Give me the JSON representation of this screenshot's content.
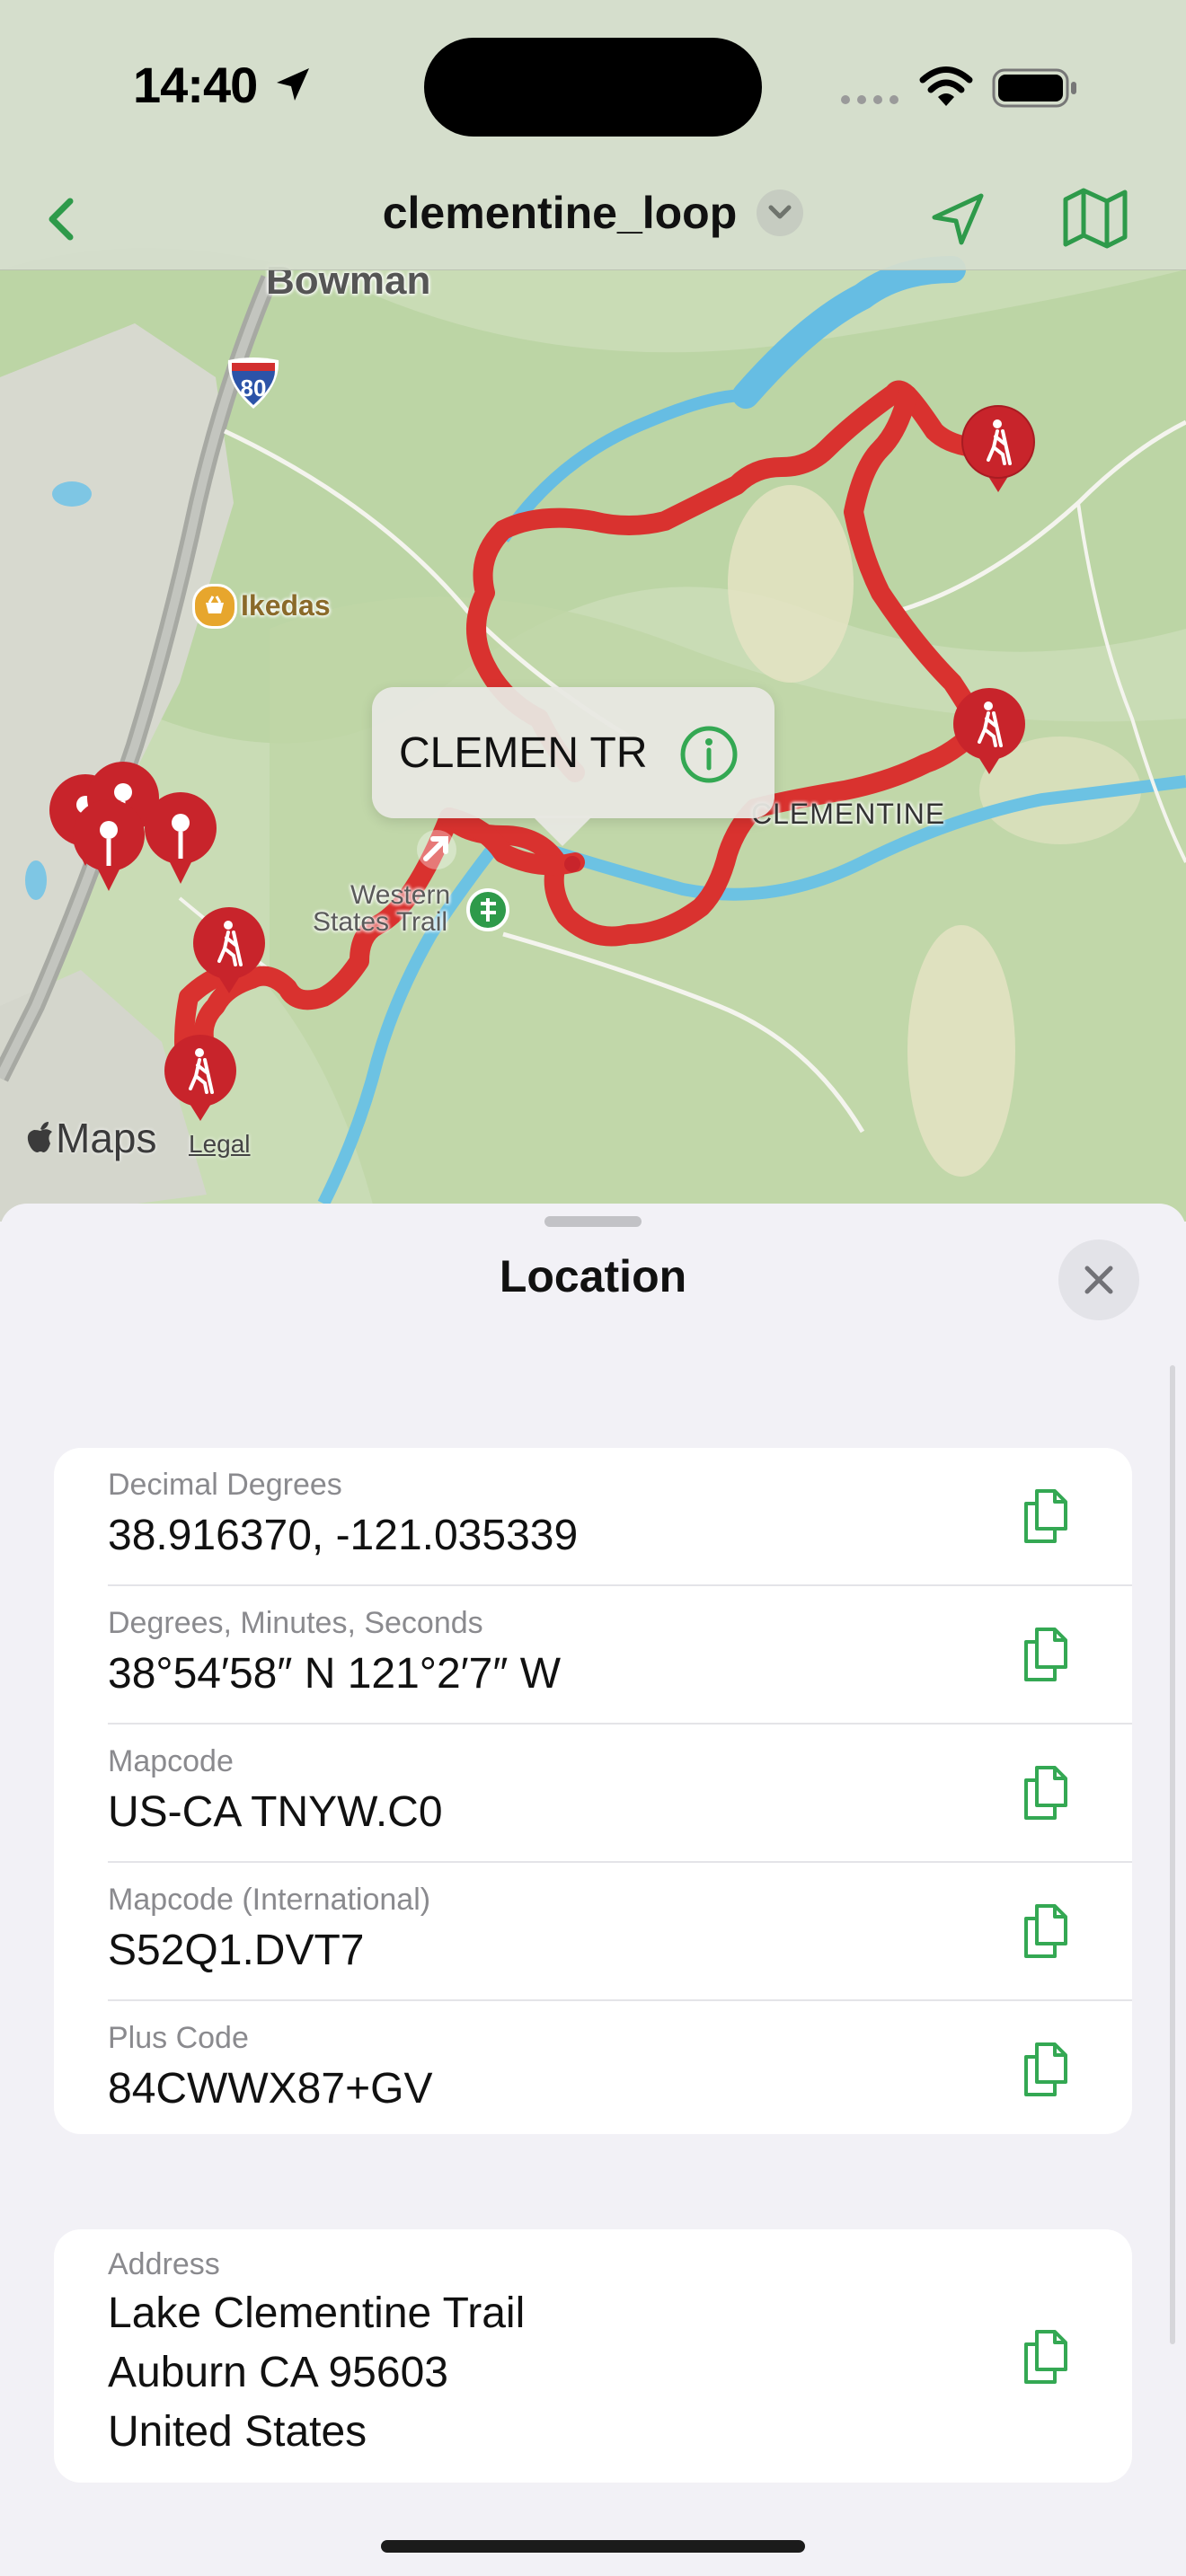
{
  "status_bar": {
    "time": "14:40"
  },
  "nav": {
    "title": "clementine_loop",
    "back_icon": "chevron-left-icon",
    "title_dropdown_icon": "chevron-down-icon",
    "location_icon": "location-arrow-icon",
    "map_type_icon": "map-icon"
  },
  "map": {
    "labels": {
      "town": "Bowman",
      "highway_shield": "80",
      "store": "Ikedas",
      "trail_name": "Western\nStates Trail",
      "trail_line1": "Western",
      "trail_line2": "States Trail",
      "area": "CLEMENTINE"
    },
    "callout": {
      "title": "CLEMEN TR",
      "info_icon": "info-circle-icon"
    },
    "attribution": {
      "logo": "Maps",
      "legal": "Legal"
    },
    "route_color": "#d9322f",
    "pin_color": "#c8242b",
    "pin_icons": [
      "hiker-pin-icon",
      "pushpin-icon"
    ]
  },
  "sheet": {
    "title": "Location",
    "close_icon": "close-icon",
    "coordinates": [
      {
        "label": "Decimal Degrees",
        "value": "38.916370, -121.035339"
      },
      {
        "label": "Degrees, Minutes, Seconds",
        "value": "38°54′58″ N 121°2′7″ W"
      },
      {
        "label": "Mapcode",
        "value": "US-CA TNYW.C0"
      },
      {
        "label": "Mapcode (International)",
        "value": "S52Q1.DVT7"
      },
      {
        "label": "Plus Code",
        "value": "84CWWX87+GV"
      }
    ],
    "address": {
      "label": "Address",
      "lines": [
        "Lake Clementine Trail",
        "Auburn CA 95603",
        "United States"
      ]
    },
    "copy_icon": "copy-document-icon",
    "accent_color": "#34a853"
  }
}
